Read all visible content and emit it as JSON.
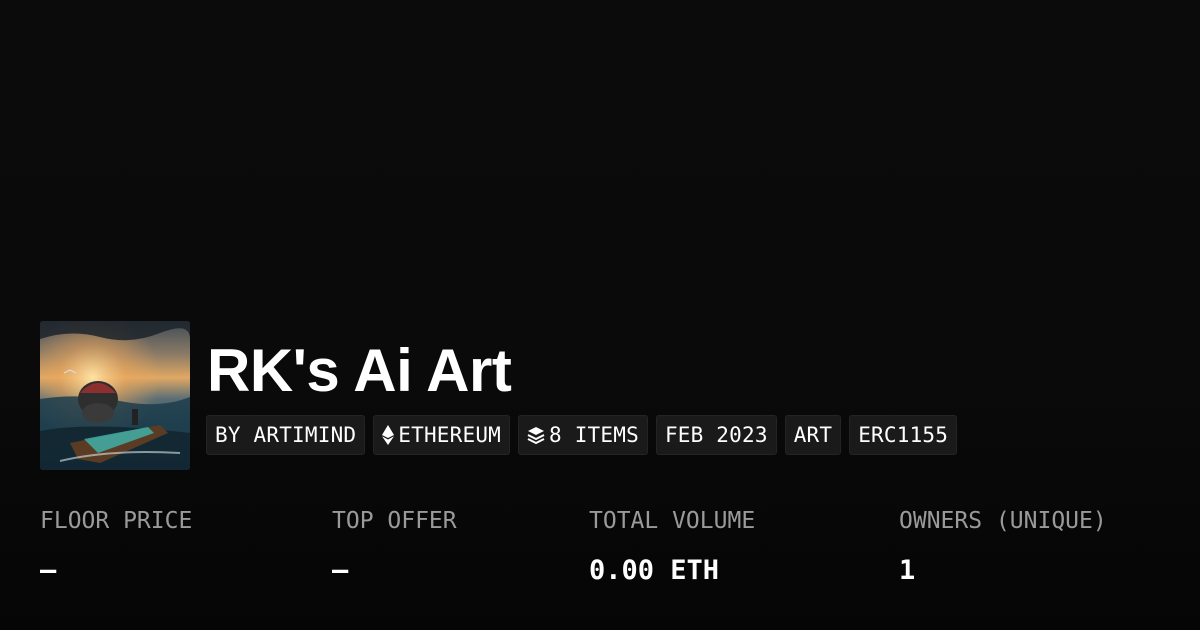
{
  "collection": {
    "title": "RK's Ai Art",
    "image_alt_icon": "collection-thumbnail"
  },
  "chips": [
    {
      "label": "BY ARTIMIND",
      "icon": ""
    },
    {
      "label": "ETHEREUM",
      "icon": "ethereum-icon"
    },
    {
      "label": "8 ITEMS",
      "icon": "layers-icon"
    },
    {
      "label": "FEB 2023",
      "icon": ""
    },
    {
      "label": "ART",
      "icon": ""
    },
    {
      "label": "ERC1155",
      "icon": ""
    }
  ],
  "stats": [
    {
      "label": "FLOOR PRICE",
      "value": "—"
    },
    {
      "label": "TOP OFFER",
      "value": "—"
    },
    {
      "label": "TOTAL VOLUME",
      "value": "0.00 ETH"
    },
    {
      "label": "OWNERS (UNIQUE)",
      "value": "1"
    }
  ],
  "colors": {
    "background": "#0a0a0a",
    "chip_bg": "#1a1a1a",
    "label": "#9a9a9a",
    "text": "#ffffff"
  }
}
